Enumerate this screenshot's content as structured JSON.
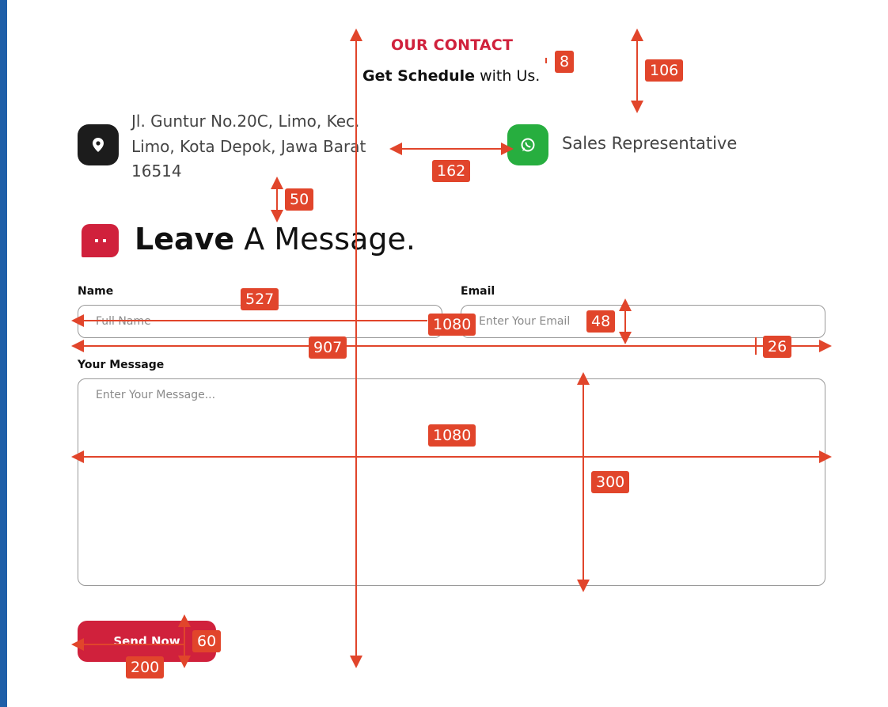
{
  "contact": {
    "eyebrow": "OUR CONTACT",
    "subheading_bold": "Get Schedule",
    "subheading_rest": " with Us."
  },
  "address": {
    "icon": "location-pin-icon",
    "line1": "Jl. Guntur No.20C, Limo, Kec.",
    "line2": "Limo, Kota Depok, Jawa Barat",
    "line3": "16514"
  },
  "whatsapp": {
    "icon": "whatsapp-icon",
    "label": "Sales Representative",
    "color": "#27ae3f"
  },
  "message_section": {
    "icon": "chat-bubble-icon",
    "title_bold": "Leave",
    "title_rest": " A Message."
  },
  "form": {
    "name_label": "Name",
    "name_placeholder": "Full Name",
    "email_label": "Email",
    "email_placeholder": "Enter Your Email",
    "message_label": "Your Message",
    "message_placeholder": "Enter Your Message...",
    "submit_label": "Send Now"
  },
  "annotations": [
    "8",
    "106",
    "162",
    "50",
    "527",
    "1080",
    "48",
    "907",
    "26",
    "1080",
    "300",
    "60",
    "200"
  ],
  "colors": {
    "accent": "#d0213c",
    "annotation": "#e1452b",
    "dark_icon": "#1c1c1c"
  }
}
